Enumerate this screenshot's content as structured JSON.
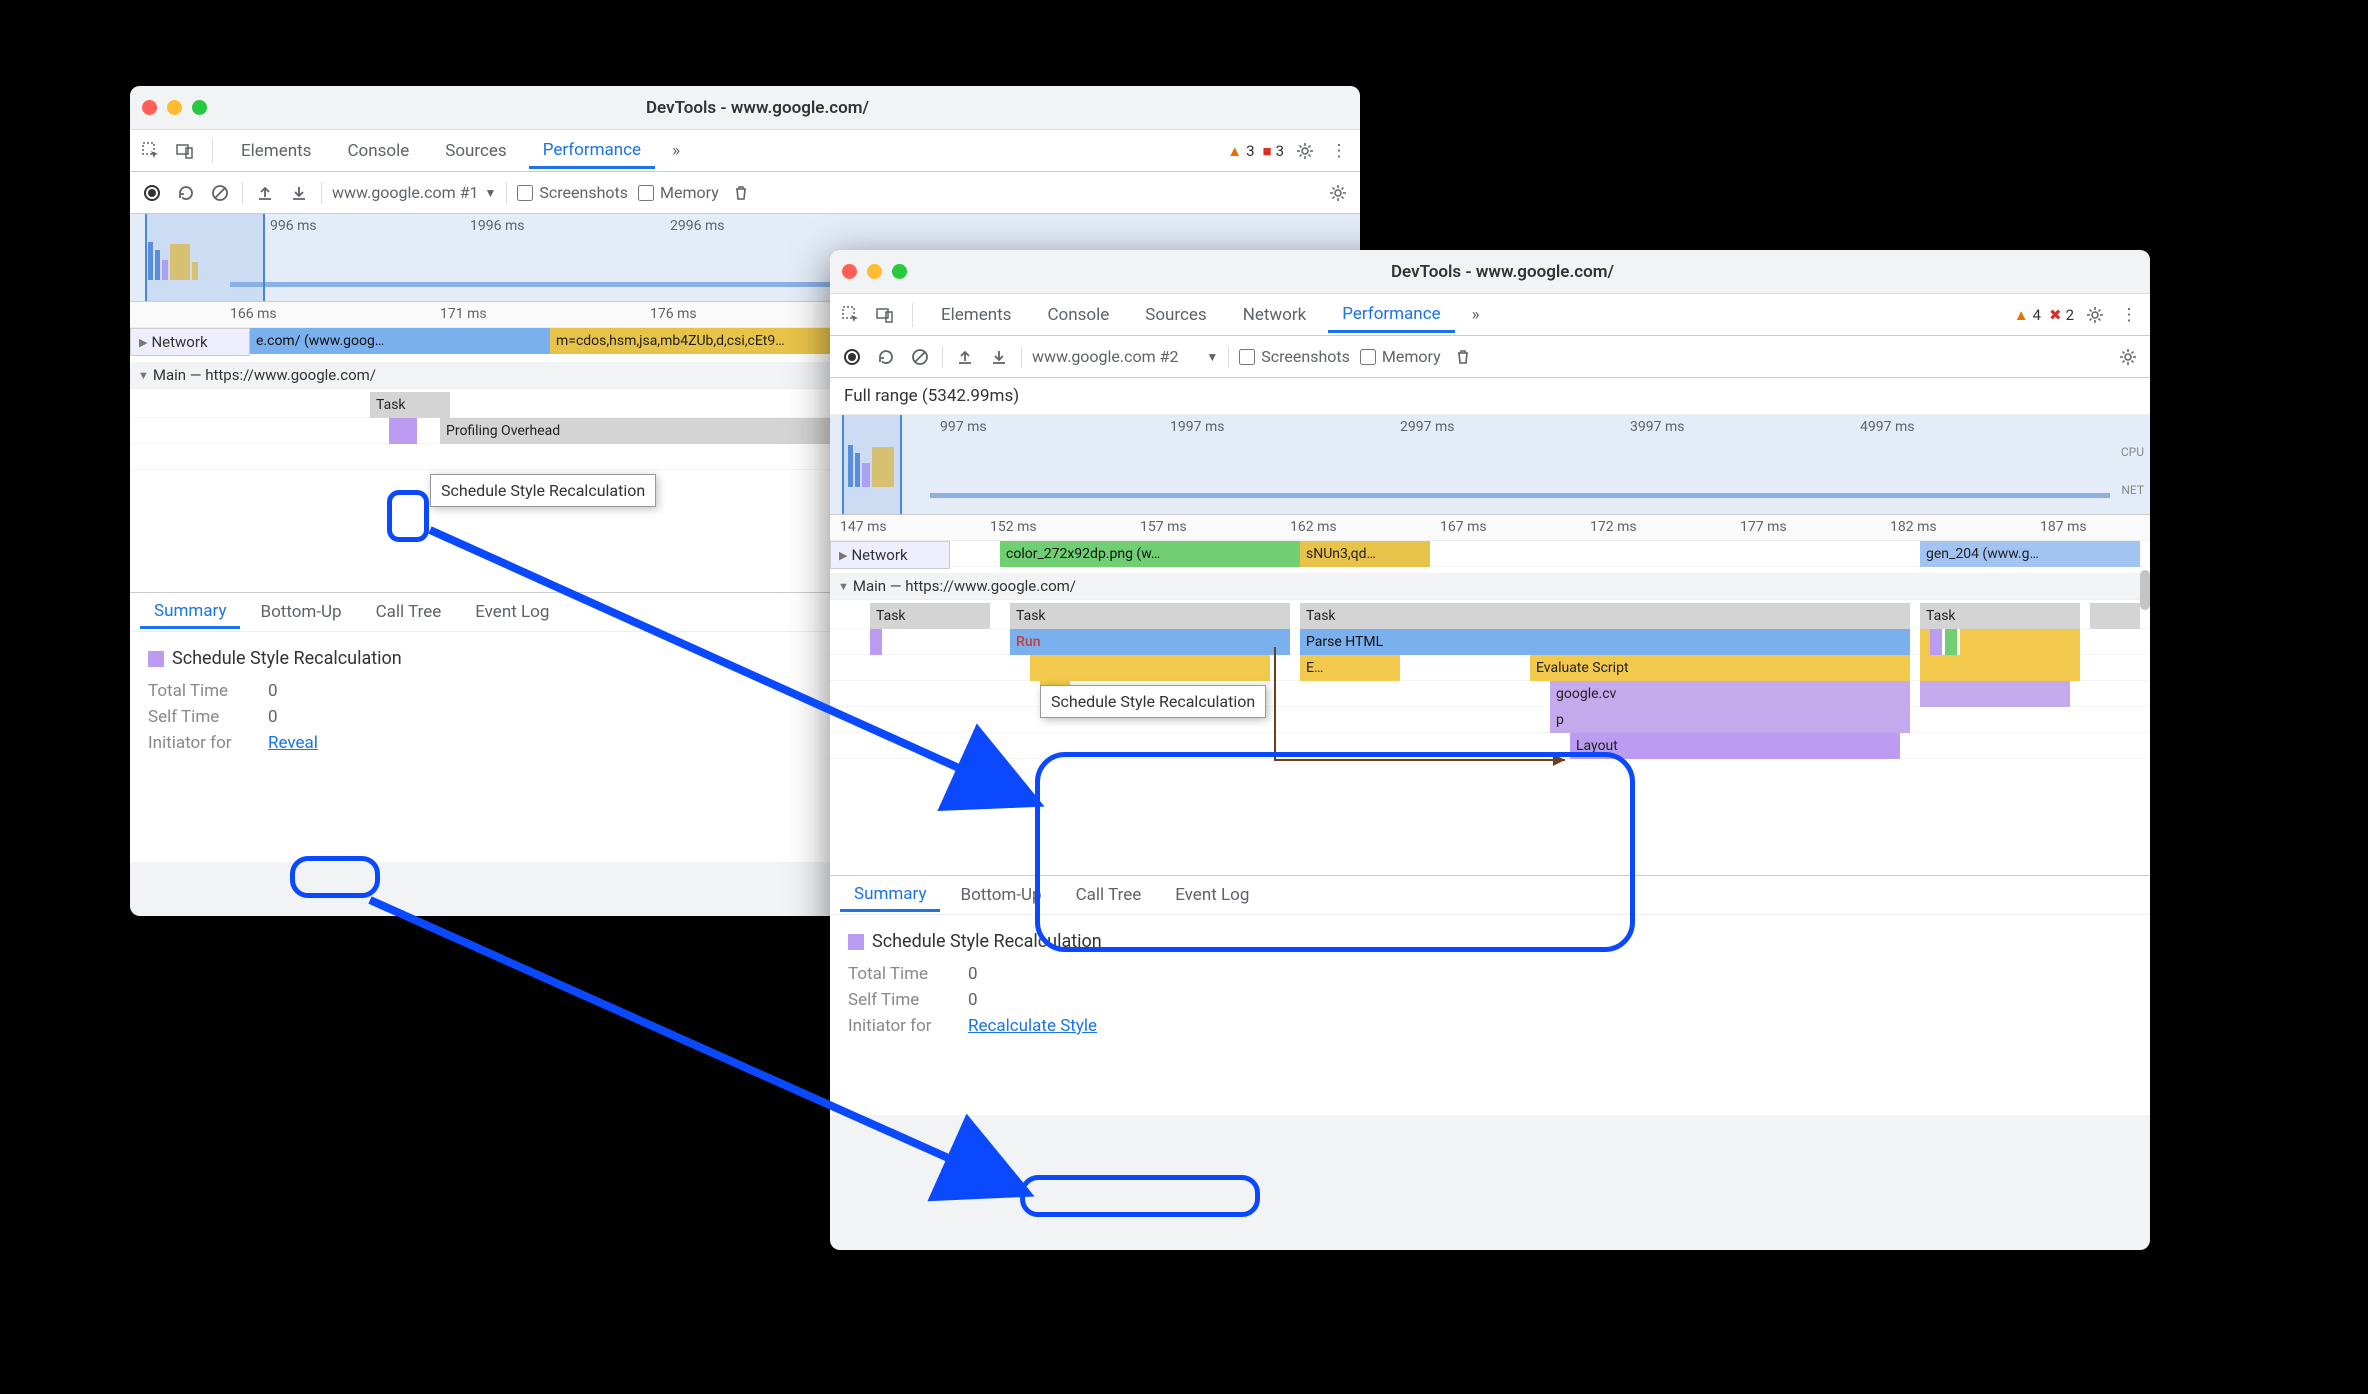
{
  "win1": {
    "title": "DevTools - www.google.com/",
    "tabs": [
      "Elements",
      "Console",
      "Sources",
      "Performance"
    ],
    "active_tab": "Performance",
    "warn_count": "3",
    "err_count": "3",
    "sub": {
      "dropdown": "www.google.com #1",
      "screenshots": "Screenshots",
      "memory": "Memory"
    },
    "overview_ticks": [
      "996 ms",
      "1996 ms",
      "2996 ms"
    ],
    "tl_ticks": [
      "166 ms",
      "171 ms",
      "176 ms"
    ],
    "network_label": "Network",
    "network_item": "e.com/ (www.goog…",
    "network_item2": "m=cdos,hsm,jsa,mb4ZUb,d,csi,cEt9…",
    "main_label": "Main — https://www.google.com/",
    "task_label": "Task",
    "profiling": "Profiling Overhead",
    "tooltip": "Schedule Style Recalculation",
    "detail_tabs": [
      "Summary",
      "Bottom-Up",
      "Call Tree",
      "Event Log"
    ],
    "detail_active": "Summary",
    "detail": {
      "heading": "Schedule Style Recalculation",
      "total_k": "Total Time",
      "total_v": "0",
      "self_k": "Self Time",
      "self_v": "0",
      "init_k": "Initiator for",
      "init_v": "Reveal"
    }
  },
  "win2": {
    "title": "DevTools - www.google.com/",
    "tabs": [
      "Elements",
      "Console",
      "Sources",
      "Network",
      "Performance"
    ],
    "active_tab": "Performance",
    "warn_count": "4",
    "err_count": "2",
    "sub": {
      "dropdown": "www.google.com #2",
      "screenshots": "Screenshots",
      "memory": "Memory"
    },
    "full_range": "Full range (5342.99ms)",
    "overview_ticks": [
      "997 ms",
      "1997 ms",
      "2997 ms",
      "3997 ms",
      "4997 ms"
    ],
    "overview_labels": [
      "CPU",
      "NET"
    ],
    "tl_ticks": [
      "147 ms",
      "152 ms",
      "157 ms",
      "162 ms",
      "167 ms",
      "172 ms",
      "177 ms",
      "182 ms",
      "187 ms"
    ],
    "network_label": "Network",
    "net_item1": "color_272x92dp.png (w…",
    "net_item2": "sNUn3,qd…",
    "net_item3": "gen_204 (www.g…",
    "main_label": "Main — https://www.google.com/",
    "task_label": "Task",
    "parse_html": "Parse HTML",
    "e_label": "E…",
    "eval_script": "Evaluate Script",
    "google_cv": "google.cv",
    "p_label": "p",
    "layout": "Layout",
    "tooltip": "Schedule Style Recalculation",
    "detail_tabs": [
      "Summary",
      "Bottom-Up",
      "Call Tree",
      "Event Log"
    ],
    "detail_active": "Summary",
    "detail": {
      "heading": "Schedule Style Recalculation",
      "total_k": "Total Time",
      "total_v": "0",
      "self_k": "Self Time",
      "self_v": "0",
      "init_k": "Initiator for",
      "init_v": "Recalculate Style"
    }
  }
}
